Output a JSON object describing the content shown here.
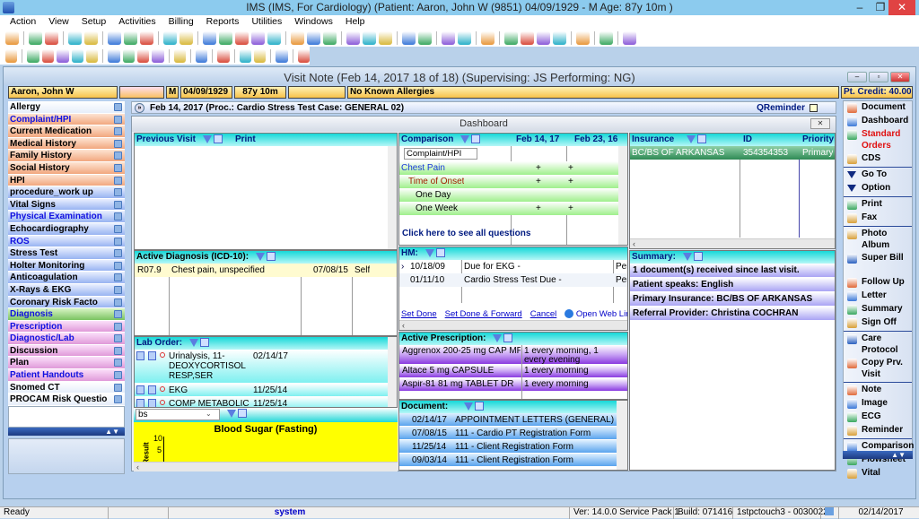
{
  "app": {
    "title": "IMS (IMS, For Cardiology)    (Patient: Aaron, John W (9851) 04/09/1929 - M Age: 87y 10m )",
    "minimize": "‒",
    "restore": "❐",
    "close": "✕"
  },
  "menu": [
    "Action",
    "View",
    "Setup",
    "Activities",
    "Billing",
    "Reports",
    "Utilities",
    "Windows",
    "Help"
  ],
  "toolbar1": [
    "patient-icon",
    "|",
    "provider-icon",
    "provider-check-icon",
    "|",
    "folder-icon",
    "edit-note-icon",
    "|",
    "report-icon",
    "lab-flask-icon",
    "shield-icon",
    "|",
    "doc-icon",
    "note-icon",
    "|",
    "billing-icon",
    "billing2-icon",
    "claims-icon",
    "payment-icon",
    "payment2-icon",
    "|",
    "calendar-icon",
    "schedule-icon",
    "letter-icon",
    "|",
    "fax-icon",
    "cds-icon",
    "cds2-icon",
    "|",
    "folder-chart-icon",
    "edit-chart-icon",
    "|",
    "bar-chart-icon",
    "person-folder-icon",
    "|",
    "report2-icon",
    "|",
    "sync-icon",
    "transfer-icon",
    "word-icon",
    "export-icon",
    "|",
    "help-icon",
    "|",
    "lock-icon",
    "|",
    "exit-icon"
  ],
  "toolbar2": [
    "open-icon",
    "|",
    "add-icon",
    "edit-icon",
    "remove-icon",
    "print-icon",
    "heart-icon",
    "|",
    "first-icon",
    "prev-icon",
    "next-icon",
    "last-icon",
    "|",
    "refresh-icon",
    "|",
    "copy-icon",
    "|",
    "template-icon",
    "|",
    "notes-icon",
    "snowflake-icon",
    "|",
    "help-icon",
    "|",
    "close-icon"
  ],
  "visit": {
    "title": "Visit Note (Feb 14, 2017   18 of 18) (Supervising: JS Performing: NG)",
    "header": "Feb 14, 2017  (Proc.: Cardio Stress Test  Case: GENERAL 02)",
    "qreminder": "QReminder"
  },
  "patient": {
    "name": "Aaron, John W",
    "sex": "M",
    "dob": "04/09/1929",
    "age": "87y 10m",
    "blank": "",
    "allergies": "No Known Allergies",
    "credit": "Pt. Credit: 40.00"
  },
  "sidebar": {
    "items": [
      {
        "label": "Allergy",
        "color": "white",
        "blue": false
      },
      {
        "label": "Complaint/HPI",
        "color": "orange",
        "blue": true
      },
      {
        "label": "Current Medication",
        "color": "orange",
        "blue": false
      },
      {
        "label": "Medical History",
        "color": "orange",
        "blue": false
      },
      {
        "label": "Family History",
        "color": "orange",
        "blue": false
      },
      {
        "label": "Social History",
        "color": "orange",
        "blue": false
      },
      {
        "label": "HPI",
        "color": "orange",
        "blue": false
      },
      {
        "label": "procedure_work up",
        "color": "blue",
        "blue": false
      },
      {
        "label": "Vital Signs",
        "color": "blue",
        "blue": false
      },
      {
        "label": "Physical Examination",
        "color": "blue",
        "blue": true
      },
      {
        "label": "Echocardiography",
        "color": "blue",
        "blue": false
      },
      {
        "label": "ROS",
        "color": "blue",
        "blue": true
      },
      {
        "label": "Stress Test",
        "color": "blue",
        "blue": false
      },
      {
        "label": "Holter Monitoring",
        "color": "blue",
        "blue": false
      },
      {
        "label": "Anticoagulation",
        "color": "blue",
        "blue": false
      },
      {
        "label": "X-Rays & EKG",
        "color": "blue",
        "blue": false
      },
      {
        "label": "Coronary Risk Facto",
        "color": "blue",
        "blue": false
      },
      {
        "label": "Diagnosis",
        "color": "green",
        "blue": true
      },
      {
        "label": "Prescription",
        "color": "pink",
        "blue": true
      },
      {
        "label": "Diagnostic/Lab",
        "color": "pink",
        "blue": true
      },
      {
        "label": "Discussion",
        "color": "pink",
        "blue": false
      },
      {
        "label": "Plan",
        "color": "pink",
        "blue": false
      },
      {
        "label": "Patient Handouts",
        "color": "pink",
        "blue": true
      },
      {
        "label": "Snomed CT",
        "color": "white",
        "blue": false
      },
      {
        "label": "PROCAM Risk Questio",
        "color": "white",
        "blue": false
      }
    ]
  },
  "dashboard": {
    "title": "Dashboard",
    "close": "✕",
    "previous_visit": {
      "title": "Previous Visit",
      "print": "Print"
    },
    "diagnosis": {
      "title": "Active Diagnosis (ICD-10):",
      "rows": [
        {
          "code": "R07.9",
          "desc": "Chest pain, unspecified",
          "date": "07/08/15",
          "by": "Self"
        }
      ]
    },
    "lab": {
      "title": "Lab Order:",
      "rows": [
        {
          "name": "Urinalysis, 11-DEOXYCORTISOL RESP,SER",
          "date": "02/14/17"
        },
        {
          "name": "EKG",
          "date": "11/25/14"
        },
        {
          "name": "COMP METABOLIC PANEL",
          "date": "11/25/14"
        }
      ]
    },
    "chart_select": {
      "value": "bs"
    },
    "chart": {
      "title": "Blood Sugar (Fasting)",
      "ylabel": "Result",
      "ticks": [
        "10",
        "5"
      ]
    },
    "comparison": {
      "title": "Comparison",
      "cols": [
        "Feb 14, 17",
        "Feb 23, 16"
      ],
      "select": "Complaint/HPI",
      "rows": [
        {
          "label": "Chest Pain",
          "indent": 0,
          "color": "#1a3ad8",
          "a": "+",
          "b": "+"
        },
        {
          "label": "Time of Onset",
          "indent": 1,
          "color": "#a02000",
          "a": "+",
          "b": "+"
        },
        {
          "label": "One Day",
          "indent": 2,
          "color": "#000",
          "a": "",
          "b": ""
        },
        {
          "label": "One Week",
          "indent": 2,
          "color": "#000",
          "a": "+",
          "b": "+"
        }
      ],
      "see_all": "Click here to see all questions"
    },
    "hm": {
      "title": "HM:",
      "rows": [
        {
          "date": "10/18/09",
          "desc": "Due for EKG  -",
          "status": "Pend"
        },
        {
          "date": "01/11/10",
          "desc": "Cardio Stress Test Due  -",
          "status": "Pend"
        }
      ],
      "actions": [
        "Set Done",
        "Set Done & Forward",
        "Cancel"
      ],
      "web_link": "Open Web Link"
    },
    "prescription": {
      "title": "Active Prescription:",
      "rows": [
        {
          "drug": "Aggrenox 200-25 mg CAP MPHASE",
          "sig": "1 every morning,  1 every evening"
        },
        {
          "drug": "Altace 5 mg CAPSULE",
          "sig": "1 every morning"
        },
        {
          "drug": "Aspir-81 81 mg TABLET DR",
          "sig": "1 every morning"
        }
      ]
    },
    "document": {
      "title": "Document:",
      "rows": [
        {
          "date": "02/14/17",
          "name": "APPOINTMENT LETTERS (GENERAL)  - Referral"
        },
        {
          "date": "07/08/15",
          "name": "111 - Cardio PT Registration Form"
        },
        {
          "date": "11/25/14",
          "name": "111 - Client Registration Form"
        },
        {
          "date": "09/03/14",
          "name": "111 - Client Registration Form"
        }
      ]
    },
    "insurance": {
      "title": "Insurance",
      "id_header": "ID",
      "priority_header": "Priority",
      "rows": [
        {
          "name": "BC/BS OF ARKANSAS",
          "id": "354354353",
          "priority": "Primary"
        }
      ]
    },
    "summary": {
      "title": "Summary:",
      "rows": [
        "1 document(s) received since last visit.",
        "Patient speaks: English",
        "Primary Insurance: BC/BS OF ARKANSAS",
        "Referral Provider: Christina COCHRAN"
      ]
    }
  },
  "rightnav": [
    [
      {
        "label": "Document",
        "icon": "document-icon"
      },
      {
        "label": "Dashboard",
        "icon": "dashboard-icon"
      },
      {
        "label": "Standard Orders",
        "icon": "orders-icon",
        "red": true
      },
      {
        "label": "CDS",
        "icon": "cds-icon"
      }
    ],
    [
      {
        "label": "Go To",
        "icon": "triangle-down-icon"
      },
      {
        "label": "Option",
        "icon": "triangle-down-icon"
      }
    ],
    [
      {
        "label": "Print",
        "icon": "print-icon"
      },
      {
        "label": "Fax",
        "icon": "fax-icon"
      }
    ],
    [
      {
        "label": "Photo Album",
        "icon": "photo-icon"
      },
      {
        "label": "Super Bill",
        "icon": "superbill-icon"
      },
      {
        "label": "Follow Up",
        "icon": "calendar-icon"
      },
      {
        "label": "Letter",
        "icon": "letter-icon"
      },
      {
        "label": "Summary",
        "icon": "summary-icon"
      },
      {
        "label": "Sign Off",
        "icon": "sign-off-icon"
      }
    ],
    [
      {
        "label": "Care Protocol",
        "icon": "clipboard-icon"
      },
      {
        "label": "Copy Prv. Visit",
        "icon": "copy-icon"
      }
    ],
    [
      {
        "label": "Note",
        "icon": "note-icon"
      },
      {
        "label": "Image",
        "icon": "image-icon"
      },
      {
        "label": "ECG",
        "icon": "ecg-icon"
      },
      {
        "label": "Reminder",
        "icon": "reminder-icon"
      }
    ],
    [
      {
        "label": "Comparison",
        "icon": "checklist-icon"
      },
      {
        "label": "Flowsheet",
        "icon": "checklist-icon"
      },
      {
        "label": "Vital",
        "icon": "checklist-icon"
      }
    ]
  ],
  "status": {
    "ready": "Ready",
    "user": "system",
    "version": "Ver: 14.0.0 Service Pack 1",
    "build": "Build: 071416",
    "station": "1stpctouch3 - 0030022",
    "date": "02/14/2017"
  }
}
